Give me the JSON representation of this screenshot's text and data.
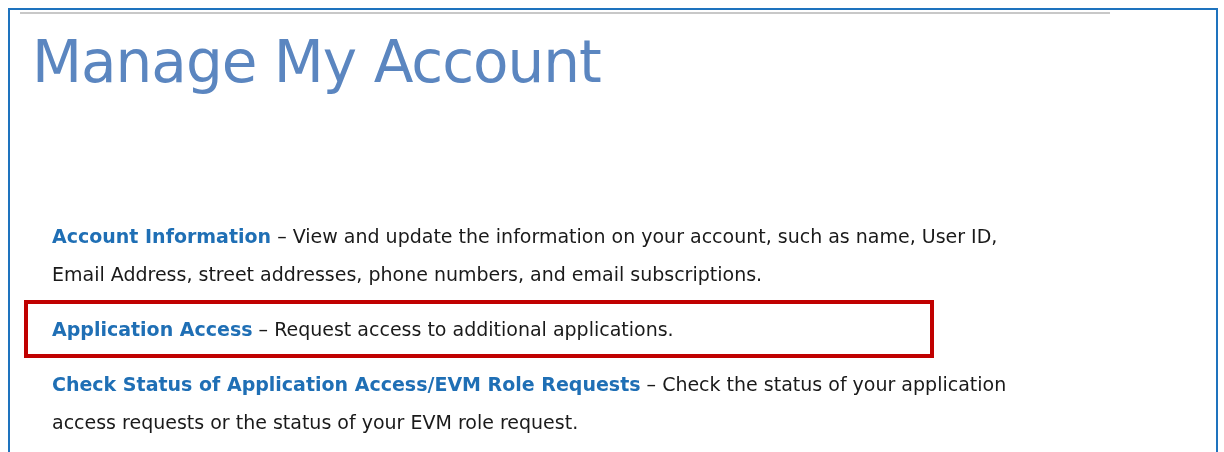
{
  "page": {
    "title": "Manage My Account"
  },
  "items": [
    {
      "link": "Account Information",
      "description": "– View and update the information on your account, such as name, User ID, Email Address, street addresses, phone numbers, and email subscriptions.",
      "highlighted": false
    },
    {
      "link": "Application Access",
      "description": "– Request access to additional applications.",
      "highlighted": true
    },
    {
      "link": "Check Status of Application Access/EVM Role Requests",
      "description": "– Check the status of your application access requests or the status of your EVM role request.",
      "highlighted": false
    }
  ]
}
